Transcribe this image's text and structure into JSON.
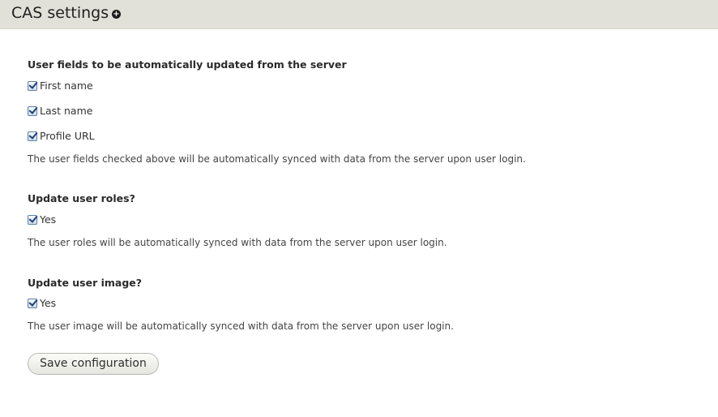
{
  "header": {
    "title": "CAS settings",
    "icon": "plus-circle-icon"
  },
  "fields_section": {
    "title": "User fields to be automatically updated from the server",
    "options": [
      {
        "label": "First name",
        "checked": true
      },
      {
        "label": "Last name",
        "checked": true
      },
      {
        "label": "Profile URL",
        "checked": true
      }
    ],
    "description": "The user fields checked above will be automatically synced with data from the server upon user login."
  },
  "roles_section": {
    "title": "Update user roles?",
    "option": {
      "label": "Yes",
      "checked": true
    },
    "description": "The user roles will be automatically synced with data from the server upon user login."
  },
  "image_section": {
    "title": "Update user image?",
    "option": {
      "label": "Yes",
      "checked": true
    },
    "description": "The user image will be automatically synced with data from the server upon user login."
  },
  "actions": {
    "save_label": "Save configuration"
  }
}
